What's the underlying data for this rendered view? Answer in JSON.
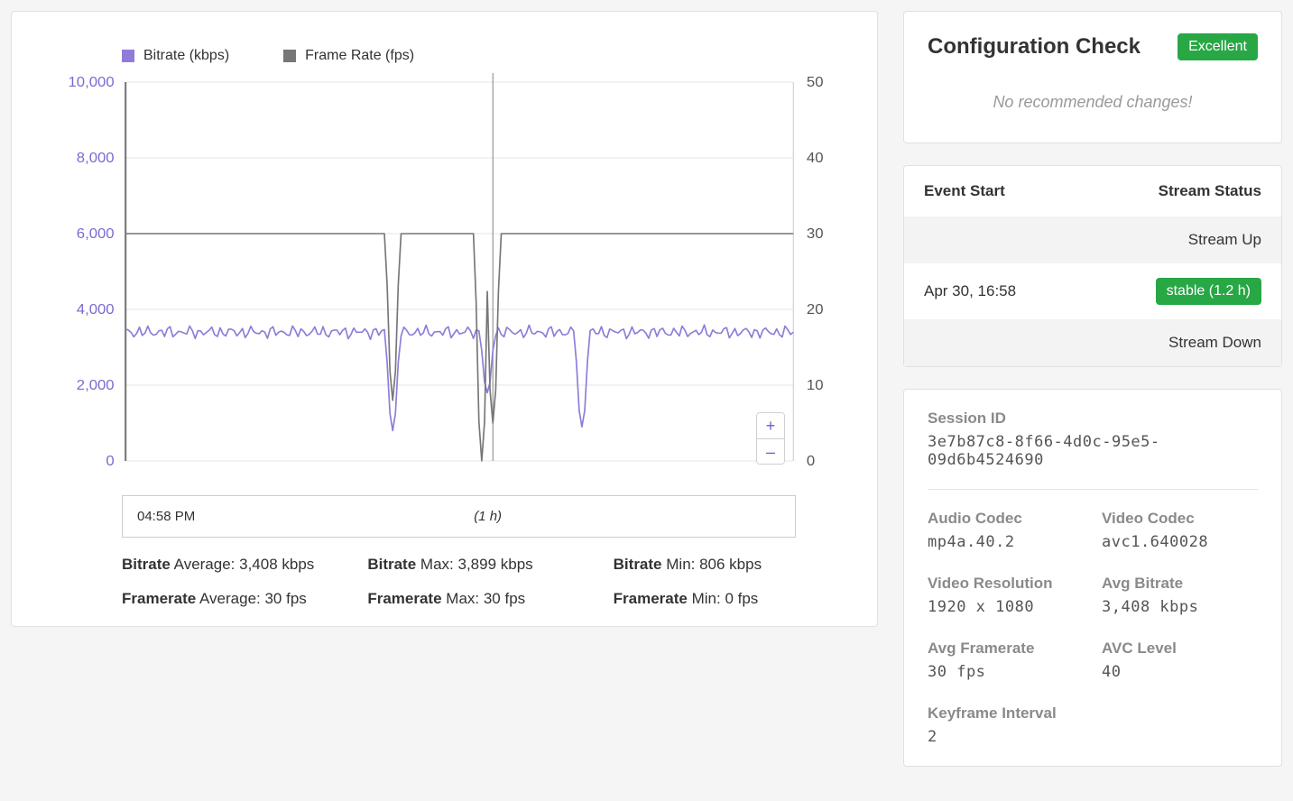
{
  "legend": {
    "bitrate": {
      "label": "Bitrate (kbps)",
      "color": "#8e7cd8"
    },
    "framerate": {
      "label": "Frame Rate (fps)",
      "color": "#777777"
    }
  },
  "zoom": {
    "in": "+",
    "out": "–"
  },
  "timeline": {
    "start": "04:58 PM",
    "duration": "(1 h)"
  },
  "stats": {
    "bitrate": {
      "label": "Bitrate",
      "avg": "Average: 3,408 kbps",
      "max": "Max: 3,899 kbps",
      "min": "Min: 806 kbps"
    },
    "framerate": {
      "label": "Framerate",
      "avg": "Average: 30 fps",
      "max": "Max: 30 fps",
      "min": "Min: 0 fps"
    }
  },
  "config": {
    "title": "Configuration Check",
    "badge": "Excellent",
    "message": "No recommended changes!"
  },
  "status": {
    "head_left": "Event Start",
    "head_right": "Stream Status",
    "rows": {
      "up": "Stream Up",
      "time": "Apr 30, 16:58",
      "pill": "stable (1.2 h)",
      "down": "Stream Down"
    }
  },
  "session": {
    "id_label": "Session ID",
    "id": "3e7b87c8-8f66-4d0c-95e5-09d6b4524690",
    "fields": {
      "audio_codec": {
        "label": "Audio Codec",
        "value": "mp4a.40.2"
      },
      "video_codec": {
        "label": "Video Codec",
        "value": "avc1.640028"
      },
      "resolution": {
        "label": "Video Resolution",
        "value": "1920 x 1080"
      },
      "avg_bitrate": {
        "label": "Avg Bitrate",
        "value": "3,408 kbps"
      },
      "avg_framerate": {
        "label": "Avg Framerate",
        "value": "30 fps"
      },
      "avc_level": {
        "label": "AVC Level",
        "value": "40"
      },
      "keyframe": {
        "label": "Keyframe Interval",
        "value": "2"
      }
    }
  },
  "chart_data": {
    "type": "line",
    "xlabel": "",
    "ylabel": "",
    "y_left": {
      "label": "Bitrate (kbps)",
      "range": [
        0,
        10000
      ],
      "ticks": [
        0,
        2000,
        4000,
        6000,
        8000,
        10000
      ],
      "tick_labels": [
        "0",
        "2,000",
        "4,000",
        "6,000",
        "8,000",
        "10,000"
      ]
    },
    "y_right": {
      "label": "Frame Rate (fps)",
      "range": [
        0,
        50
      ],
      "ticks": [
        0,
        10,
        20,
        30,
        40,
        50
      ]
    },
    "x_range_minutes": [
      0,
      60
    ],
    "series": [
      {
        "name": "Bitrate (kbps)",
        "axis": "left",
        "color": "#8e7cd8",
        "baseline": 3400,
        "noise_amplitude": 200,
        "dips": [
          {
            "x": 24,
            "value": 800
          },
          {
            "x": 32.5,
            "value": 1800
          },
          {
            "x": 41,
            "value": 900
          }
        ]
      },
      {
        "name": "Frame Rate (fps)",
        "axis": "right",
        "color": "#777777",
        "baseline": 30,
        "noise_amplitude": 0,
        "dips": [
          {
            "x": 24,
            "value": 8
          },
          {
            "x": 32,
            "value": 0
          },
          {
            "x": 33,
            "value": 5
          }
        ]
      }
    ],
    "annotations": {
      "cursor_x_minutes": 33
    }
  }
}
